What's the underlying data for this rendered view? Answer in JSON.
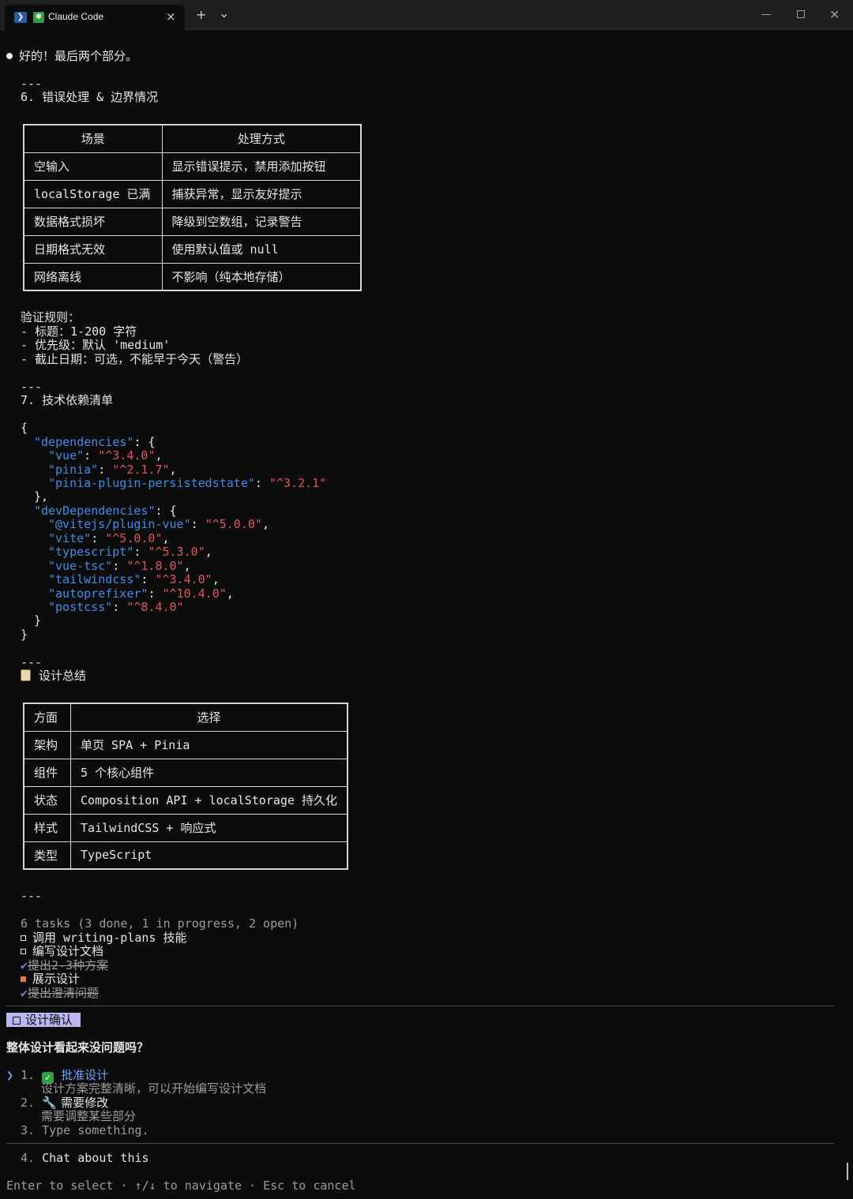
{
  "window": {
    "tab_title": "Claude Code",
    "new_tab": "+",
    "dropdown": "⌄",
    "close_tab": "×",
    "close_window": "✕"
  },
  "msg": {
    "intro": "好的！最后两个部分。",
    "sep1": "---",
    "section6": "6. 错误处理 & 边界情况",
    "error_table": {
      "headers": [
        "场景",
        "处理方式"
      ],
      "rows": [
        [
          "空输入",
          "显示错误提示，禁用添加按钮"
        ],
        [
          "localStorage 已满",
          "捕获异常，显示友好提示"
        ],
        [
          "数据格式损坏",
          "降级到空数组，记录警告"
        ],
        [
          "日期格式无效",
          "使用默认值或 null"
        ],
        [
          "网络离线",
          "不影响（纯本地存储）"
        ]
      ]
    },
    "validation_title": "验证规则：",
    "validation": [
      "- 标题：1-200 字符",
      "- 优先级：默认 'medium'",
      "- 截止日期：可选，不能早于今天（警告）"
    ],
    "sep2": "---",
    "section7": "7. 技术依赖清单",
    "json": {
      "open": "{",
      "deps_key": "\"dependencies\"",
      "deps": [
        [
          "\"vue\"",
          "\"^3.4.0\""
        ],
        [
          "\"pinia\"",
          "\"^2.1.7\""
        ],
        [
          "\"pinia-plugin-persistedstate\"",
          "\"^3.2.1\""
        ]
      ],
      "dev_key": "\"devDependencies\"",
      "dev": [
        [
          "\"@vitejs/plugin-vue\"",
          "\"^5.0.0\""
        ],
        [
          "\"vite\"",
          "\"^5.0.0\""
        ],
        [
          "\"typescript\"",
          "\"^5.3.0\""
        ],
        [
          "\"vue-tsc\"",
          "\"^1.8.0\""
        ],
        [
          "\"tailwindcss\"",
          "\"^3.4.0\""
        ],
        [
          "\"autoprefixer\"",
          "\"^10.4.0\""
        ],
        [
          "\"postcss\"",
          "\"^8.4.0\""
        ]
      ],
      "close": "}"
    },
    "sep3": "---",
    "summary_title": "设计总结",
    "summary_table": {
      "headers": [
        "方面",
        "选择"
      ],
      "rows": [
        [
          "架构",
          "单页 SPA + Pinia"
        ],
        [
          "组件",
          "5 个核心组件"
        ],
        [
          "状态",
          "Composition API + localStorage 持久化"
        ],
        [
          "样式",
          "TailwindCSS + 响应式"
        ],
        [
          "类型",
          "TypeScript"
        ]
      ]
    },
    "sep4": "---"
  },
  "tasks": {
    "summary": "6 tasks (3 done, 1 in progress, 2 open)",
    "items": [
      {
        "label": "调用 writing-plans 技能",
        "state": "open"
      },
      {
        "label": "编写设计文档",
        "state": "open"
      },
      {
        "label": "提出2-3种方案",
        "state": "done"
      },
      {
        "label": "展示设计",
        "state": "progress"
      },
      {
        "label": "提出澄清问题",
        "state": "done"
      }
    ]
  },
  "dialog": {
    "tag": "设计确认",
    "question": "整体设计看起来没问题吗？",
    "options": [
      {
        "num": "1.",
        "label": "批准设计",
        "desc": "设计方案完整清晰，可以开始编写设计文档"
      },
      {
        "num": "2.",
        "label": "需要修改",
        "desc": "需要调整某些部分"
      },
      {
        "num": "3.",
        "label": "Type something."
      },
      {
        "num": "4.",
        "label": "Chat about this"
      }
    ],
    "footer": "Enter to select · ↑/↓ to navigate · Esc to cancel"
  }
}
